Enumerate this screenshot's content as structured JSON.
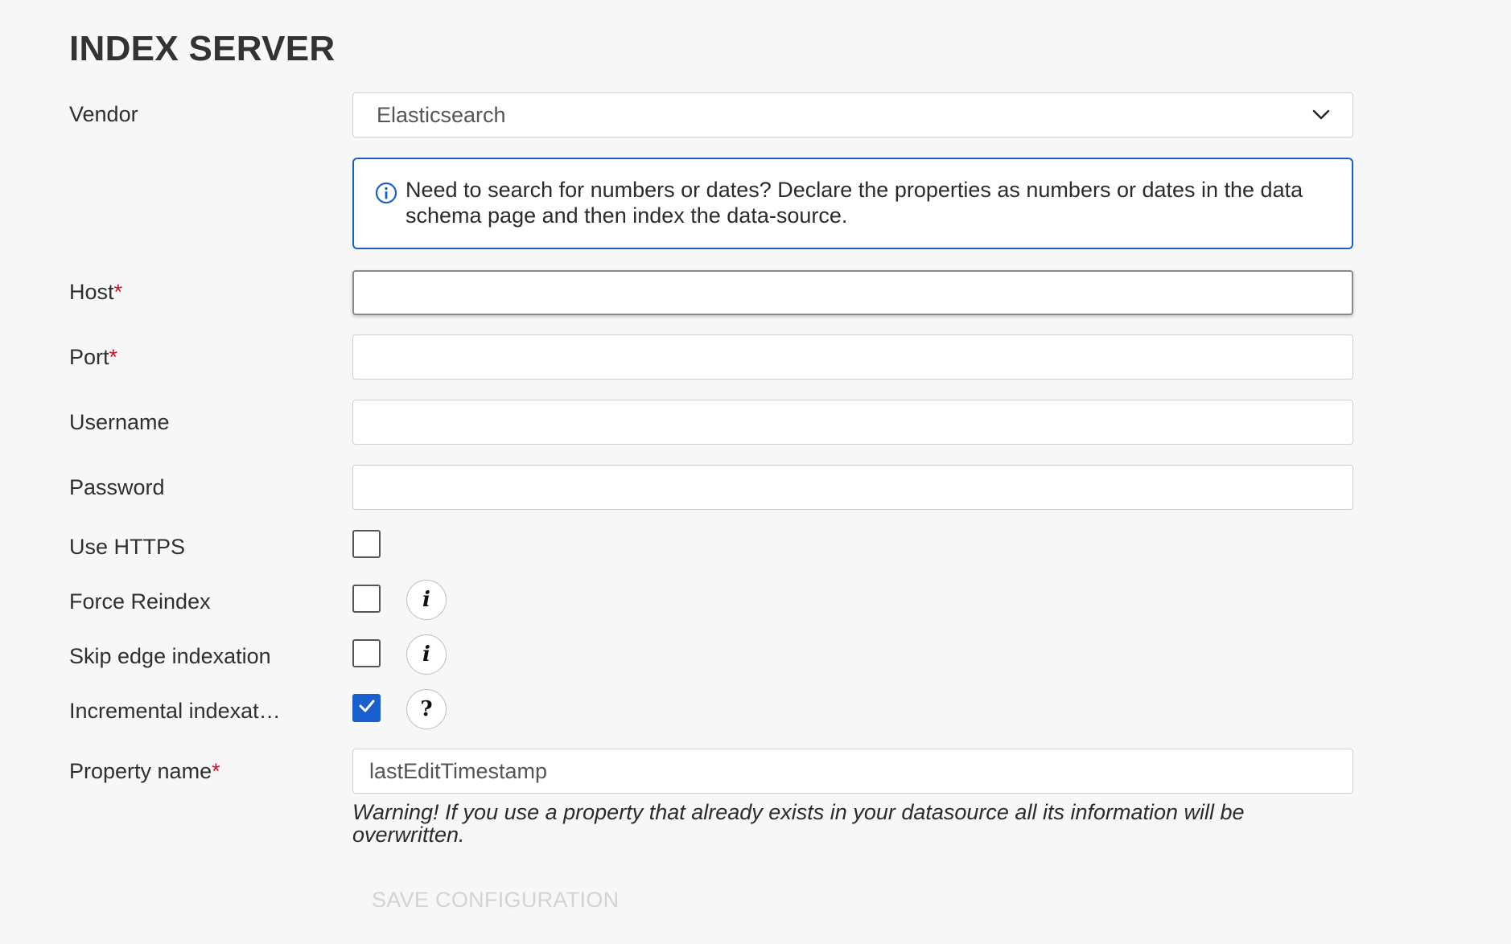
{
  "page": {
    "title": "INDEX SERVER"
  },
  "vendor": {
    "label": "Vendor",
    "value": "Elasticsearch"
  },
  "info": {
    "message": "Need to search for numbers or dates? Declare the properties as numbers or dates in the data schema page and then index the data-source."
  },
  "host": {
    "label": "Host",
    "required_mark": "*",
    "value": ""
  },
  "port": {
    "label": "Port",
    "required_mark": "*",
    "value": ""
  },
  "username": {
    "label": "Username",
    "value": ""
  },
  "password": {
    "label": "Password",
    "value": ""
  },
  "use_https": {
    "label": "Use HTTPS",
    "checked": false
  },
  "force_reindex": {
    "label": "Force Reindex",
    "checked": false,
    "help_glyph": "i"
  },
  "skip_edge_indexation": {
    "label": "Skip edge indexation",
    "checked": false,
    "help_glyph": "i"
  },
  "incremental_indexation": {
    "label": "Incremental indexat…",
    "checked": true,
    "help_glyph": "?"
  },
  "property_name": {
    "label": "Property name",
    "required_mark": "*",
    "value": "lastEditTimestamp",
    "warning": "Warning! If you use a property that already exists in your datasource all its information will be overwritten."
  },
  "actions": {
    "save_label": "SAVE CONFIGURATION"
  },
  "colors": {
    "accent": "#1a5fd0",
    "required": "#c8102e",
    "background": "#f6f7f6",
    "disabled_text": "#d3d3d3"
  },
  "icons": {
    "dropdown": "chevron-down-icon",
    "info": "info-circle-icon",
    "check": "checkmark-icon"
  }
}
